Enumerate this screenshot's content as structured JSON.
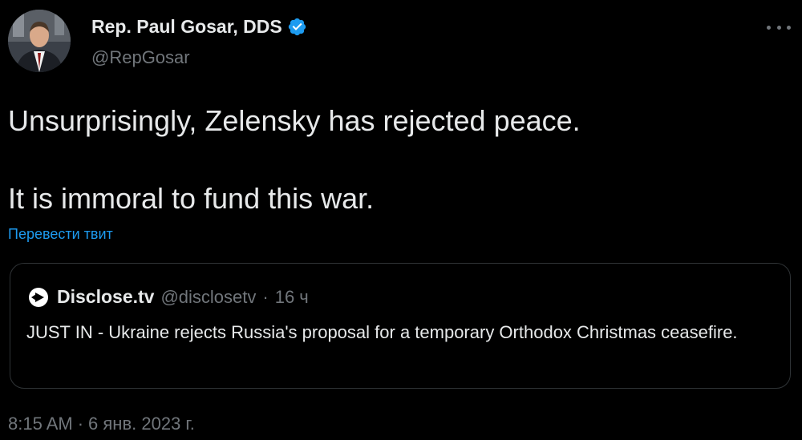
{
  "author": {
    "name": "Rep. Paul Gosar, DDS",
    "handle": "@RepGosar",
    "verified_icon": "verified-badge-icon"
  },
  "tweet": {
    "line1": "Unsurprisingly, Zelensky has rejected peace.",
    "line2": "It is immoral to fund this war.",
    "translate_label": "Перевести твит"
  },
  "quote": {
    "name": "Disclose.tv",
    "handle": "@disclosetv",
    "separator": "·",
    "time": "16 ч",
    "text": "JUST IN - Ukraine rejects Russia's proposal for a temporary Orthodox Christmas ceasefire."
  },
  "footer": {
    "time": "8:15 AM",
    "separator": "·",
    "date": "6 янв. 2023 г."
  },
  "colors": {
    "background": "#000000",
    "text": "#e7e9ea",
    "secondary": "#71767b",
    "link": "#1d9bf0",
    "border": "#2f3336"
  }
}
